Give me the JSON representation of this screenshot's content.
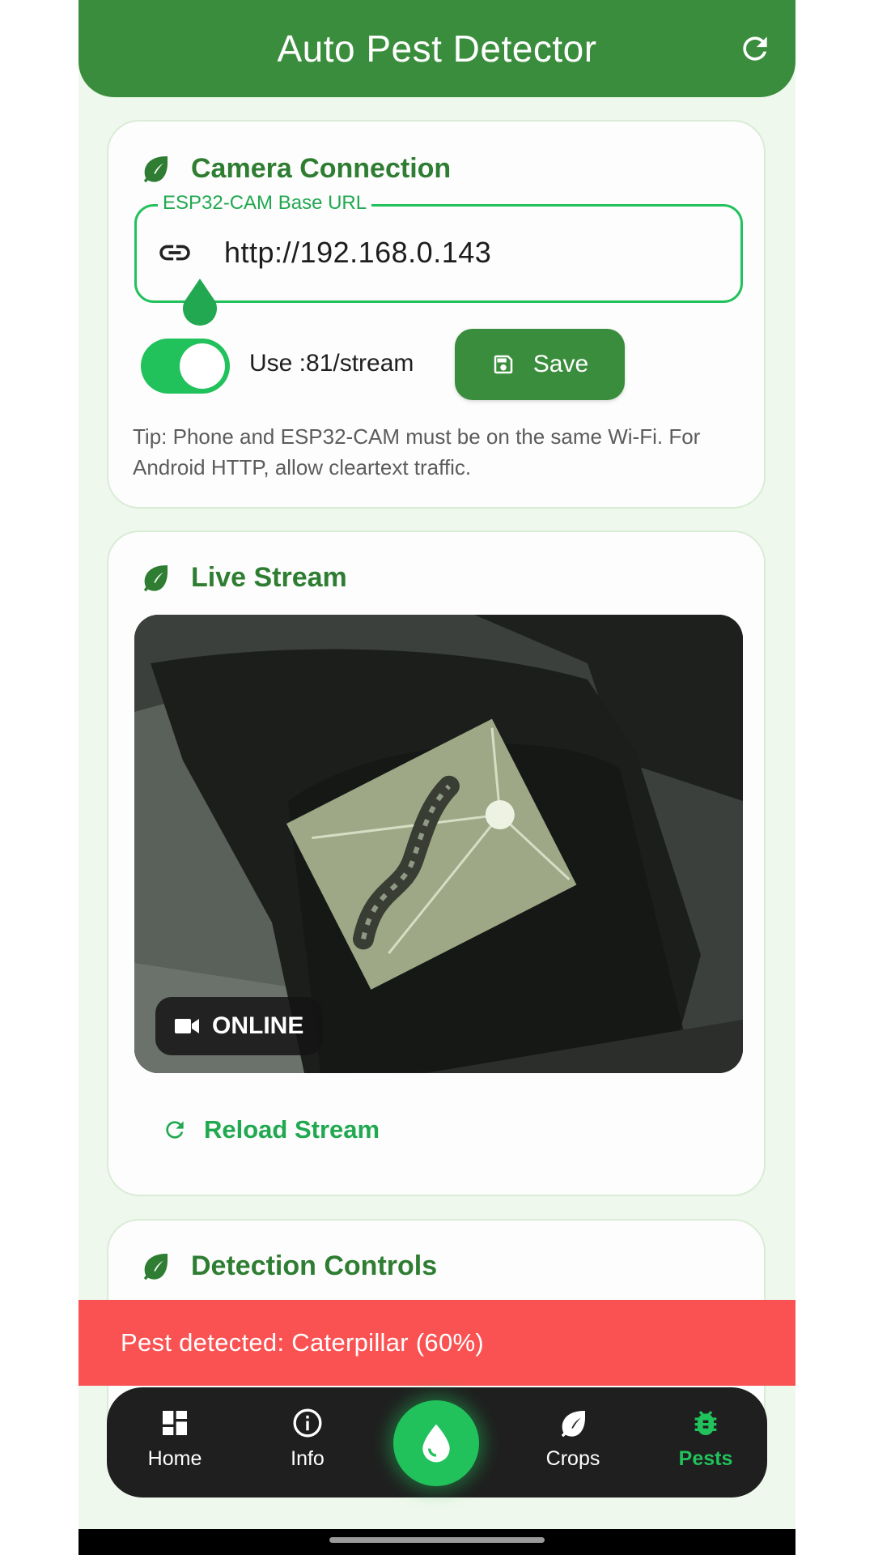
{
  "app": {
    "title": "Auto Pest Detector",
    "accent_color": "#3a8d3c",
    "active_color": "#21c15c",
    "refresh_icon": "refresh-icon"
  },
  "camera_connection": {
    "title": "Camera Connection",
    "url_field": {
      "label": "ESP32-CAM Base URL",
      "value": "http://192.168.0.143",
      "icon": "link-icon"
    },
    "toggle": {
      "label": "Use :81/stream",
      "on": true
    },
    "save_button": {
      "label": "Save",
      "icon": "save-icon"
    },
    "tip": "Tip: Phone and ESP32-CAM must be on the same Wi-Fi. For Android HTTP, allow cleartext traffic."
  },
  "live_stream": {
    "title": "Live Stream",
    "status": "ONLINE",
    "status_icon": "videocam-icon",
    "reload_label": "Reload Stream"
  },
  "detection_controls": {
    "title": "Detection Controls"
  },
  "snackbar": {
    "message": "Pest detected: Caterpillar (60%)",
    "color": "#fa5252"
  },
  "bottom_nav": {
    "items": [
      {
        "label": "Home",
        "icon": "dashboard-icon"
      },
      {
        "label": "Info",
        "icon": "info-icon"
      },
      {
        "label": "Crops",
        "icon": "leaf-icon"
      },
      {
        "label": "Pests",
        "icon": "bug-icon",
        "active": true
      }
    ],
    "fab_icon": "water-drop-icon"
  }
}
